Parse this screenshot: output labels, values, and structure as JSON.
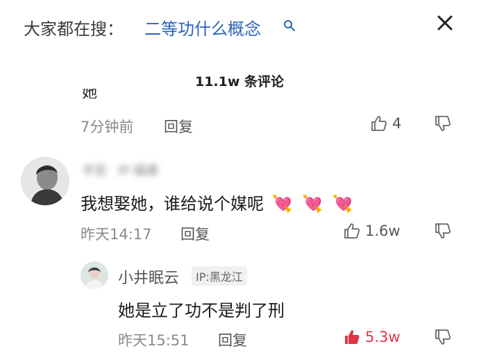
{
  "search": {
    "prefix": "大家都在搜：",
    "query": "二等功什么概念"
  },
  "comments_header": {
    "count_text": "11.1w 条评论"
  },
  "comment_prev": {
    "partial_text": "她",
    "time": "7分钟前",
    "reply_label": "回复",
    "likes": "4"
  },
  "comment_main": {
    "username": "羊驼",
    "ip": "IP:福建",
    "text": "我想娶她，谁给说个媒呢",
    "emojis": [
      "💘",
      "💘",
      "💘"
    ],
    "time": "昨天14:17",
    "reply_label": "回复",
    "likes": "1.6w"
  },
  "reply": {
    "username": "小井眠云",
    "ip": "IP:黑龙江",
    "text": "她是立了功不是判了刑",
    "time": "昨天15:51",
    "reply_label": "回复",
    "likes": "5.3w",
    "liked": true
  },
  "colors": {
    "link": "#2b63b6",
    "liked": "#e0334a",
    "meta": "#8a8a8a"
  },
  "icons": {
    "search": "search-icon",
    "close": "close-icon",
    "like": "thumbs-up-icon",
    "dislike": "thumbs-down-icon"
  }
}
